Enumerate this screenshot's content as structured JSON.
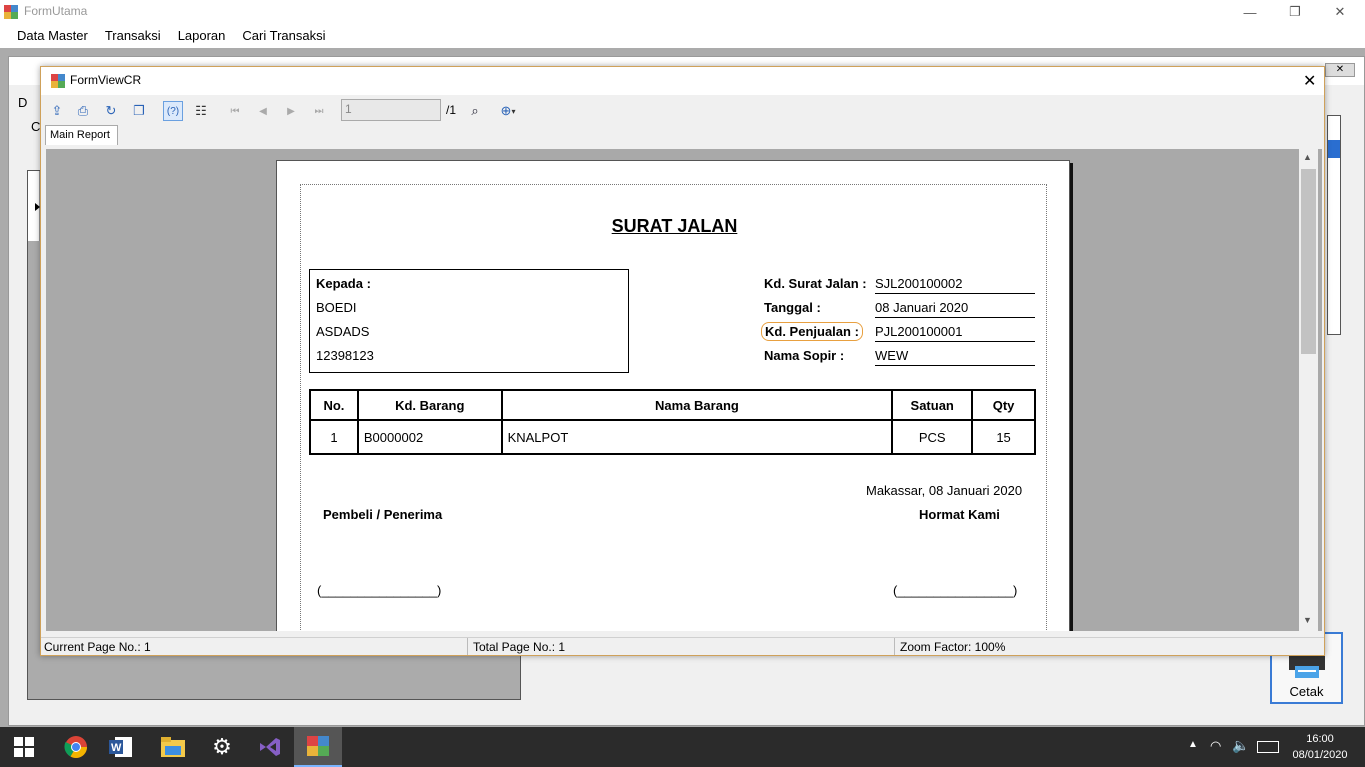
{
  "window": {
    "title": "FormUtama",
    "minimize": "—",
    "maximize": "❐",
    "close": "✕"
  },
  "menu": [
    "Data Master",
    "Transaksi",
    "Laporan",
    "Cari Transaksi"
  ],
  "back_form": {
    "label_d": "D",
    "label_c": "C",
    "cetak": "Cetak"
  },
  "viewer_form": {
    "title": "FormViewCR",
    "close": "✕",
    "page_value": "1",
    "page_total": "/1",
    "tab": "Main Report"
  },
  "report": {
    "title": "SURAT JALAN",
    "kepada_label": "Kepada :",
    "customer_name": "BOEDI",
    "customer_address": "ASDADS",
    "customer_phone": "12398123",
    "fields": [
      {
        "label": "Kd. Surat Jalan :",
        "value": "SJL200100002"
      },
      {
        "label": "Tanggal :",
        "value": "08 Januari 2020"
      },
      {
        "label": "Kd. Penjualan :",
        "value": "PJL200100001"
      },
      {
        "label": "Nama Sopir :",
        "value": "WEW"
      }
    ],
    "columns": [
      "No.",
      "Kd. Barang",
      "Nama Barang",
      "Satuan",
      "Qty"
    ],
    "rows": [
      [
        "1",
        "B0000002",
        "KNALPOT",
        "PCS",
        "15"
      ]
    ],
    "place_date": "Makassar, 08 Januari 2020",
    "buyer_label": "Pembeli / Penerima",
    "seller_label": "Hormat Kami",
    "sign_left": "(________________)",
    "sign_right": "(________________)"
  },
  "status": {
    "current_page": "Current Page No.: 1",
    "total_page": "Total Page No.: 1",
    "zoom": "Zoom Factor: 100%"
  },
  "taskbar": {
    "time": "16:00",
    "date": "08/01/2020"
  }
}
